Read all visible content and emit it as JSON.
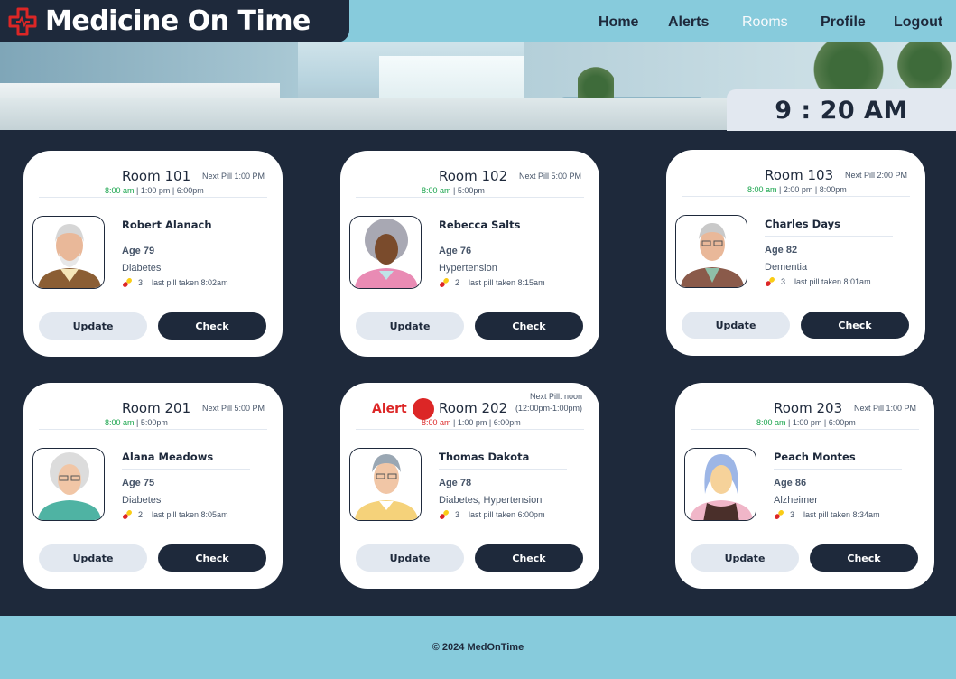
{
  "brand": {
    "name": "Medicine On Time",
    "accent": "#dc2626"
  },
  "nav": {
    "items": [
      "Home",
      "Alerts",
      "Rooms",
      "Profile",
      "Logout"
    ],
    "active": "Rooms"
  },
  "clock": {
    "time": "9 : 20 AM"
  },
  "rooms": [
    {
      "room": "Room 101",
      "next_pill": "Next Pill 1:00 PM",
      "times": [
        "8:00 am",
        "1:00 pm",
        "6:00pm"
      ],
      "name": "Robert Alanach",
      "age": "Age 79",
      "condition": "Diabetes",
      "pill_count": "3",
      "last_pill": "last pill taken 8:02am",
      "update": "Update",
      "check": "Check"
    },
    {
      "room": "Room 102",
      "next_pill": "Next Pill 5:00 PM",
      "times": [
        "8:00 am",
        "5:00pm"
      ],
      "name": "Rebecca Salts",
      "age": "Age 76",
      "condition": "Hypertension",
      "pill_count": "2",
      "last_pill": "last pill taken 8:15am",
      "update": "Update",
      "check": "Check"
    },
    {
      "room": "Room 103",
      "next_pill": "Next Pill 2:00 PM",
      "times": [
        "8:00 am",
        "2:00 pm",
        "8:00pm"
      ],
      "name": "Charles Days",
      "age": "Age 82",
      "condition": "Dementia",
      "pill_count": "3",
      "last_pill": "last pill taken 8:01am",
      "update": "Update",
      "check": "Check"
    },
    {
      "room": "Room 201",
      "next_pill": "Next Pill 5:00 PM",
      "times": [
        "8:00 am",
        "5:00pm"
      ],
      "name": "Alana Meadows",
      "age": "Age 75",
      "condition": "Diabetes",
      "pill_count": "2",
      "last_pill": "last pill taken 8:05am",
      "update": "Update",
      "check": "Check"
    },
    {
      "room": "Room 202",
      "alert": "Alert",
      "next_pill_line1": "Next Pill: noon",
      "next_pill_line2": "(12:00pm-1:00pm)",
      "times": [
        "8:00 am",
        "1:00 pm",
        "6:00pm"
      ],
      "name": "Thomas Dakota",
      "age": "Age 78",
      "condition": "Diabetes, Hypertension",
      "pill_count": "3",
      "last_pill": "last pill taken 6:00pm",
      "update": "Update",
      "check": "Check"
    },
    {
      "room": "Room 203",
      "next_pill": "Next Pill 1:00 PM",
      "times": [
        "8:00 am",
        "1:00 pm",
        "6:00pm"
      ],
      "name": "Peach Montes",
      "age": "Age 86",
      "condition": "Alzheimer",
      "pill_count": "3",
      "last_pill": "last pill taken 8:34am",
      "update": "Update",
      "check": "Check"
    }
  ],
  "footer": {
    "text": "© 2024 MedOnTime"
  }
}
